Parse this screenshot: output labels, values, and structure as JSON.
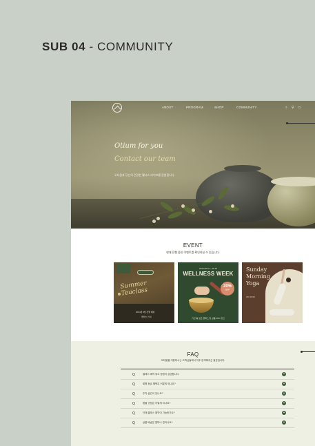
{
  "page_title": {
    "bold": "SUB 04",
    "rest": " - COMMUNITY"
  },
  "nav": {
    "items": [
      "ABOUT",
      "PROGRAM",
      "SHOP",
      "COMMUNITY"
    ],
    "icons": [
      "search-icon",
      "user-icon",
      "cart-icon"
    ]
  },
  "hero": {
    "title1": "Otium for you",
    "title2": "Contact our team",
    "desc": "오티움과 당신의 건강한 웰니스 라이프를 응원합니다."
  },
  "event": {
    "title": "EVENT",
    "subtitle": "현재 진행 중인 이벤트를 확인하실 수 있습니다.",
    "cards": [
      {
        "script": "Summer\nTeaclass",
        "info": "2024년 8월 진행 예정",
        "info2": "클래스 안내"
      },
      {
        "date": "2024.08.01 ~ 08.15",
        "title": "WELLNESS WEEK",
        "discount": "20%",
        "off": "OFF",
        "note": "기간 중 모든 클래스 및 상품 20% 할인"
      },
      {
        "title": "Sunday\nMorning\nYoga",
        "time": "AM 10:00"
      }
    ]
  },
  "faq": {
    "title": "FAQ",
    "subtitle": "오티움을 이용하시는 고객님들께서 자주 문의해주신 질문입니다.",
    "items": [
      "클래스 예약 취소 방법이 궁금합니다.",
      "회원 등급 혜택은 어떻게 되나요?",
      "주차 공간이 있나요?",
      "환불 규정은 어떻게 되나요?",
      "단체 클래스 예약이 가능한가요?",
      "상품 배송은 얼마나 걸리나요?"
    ]
  }
}
